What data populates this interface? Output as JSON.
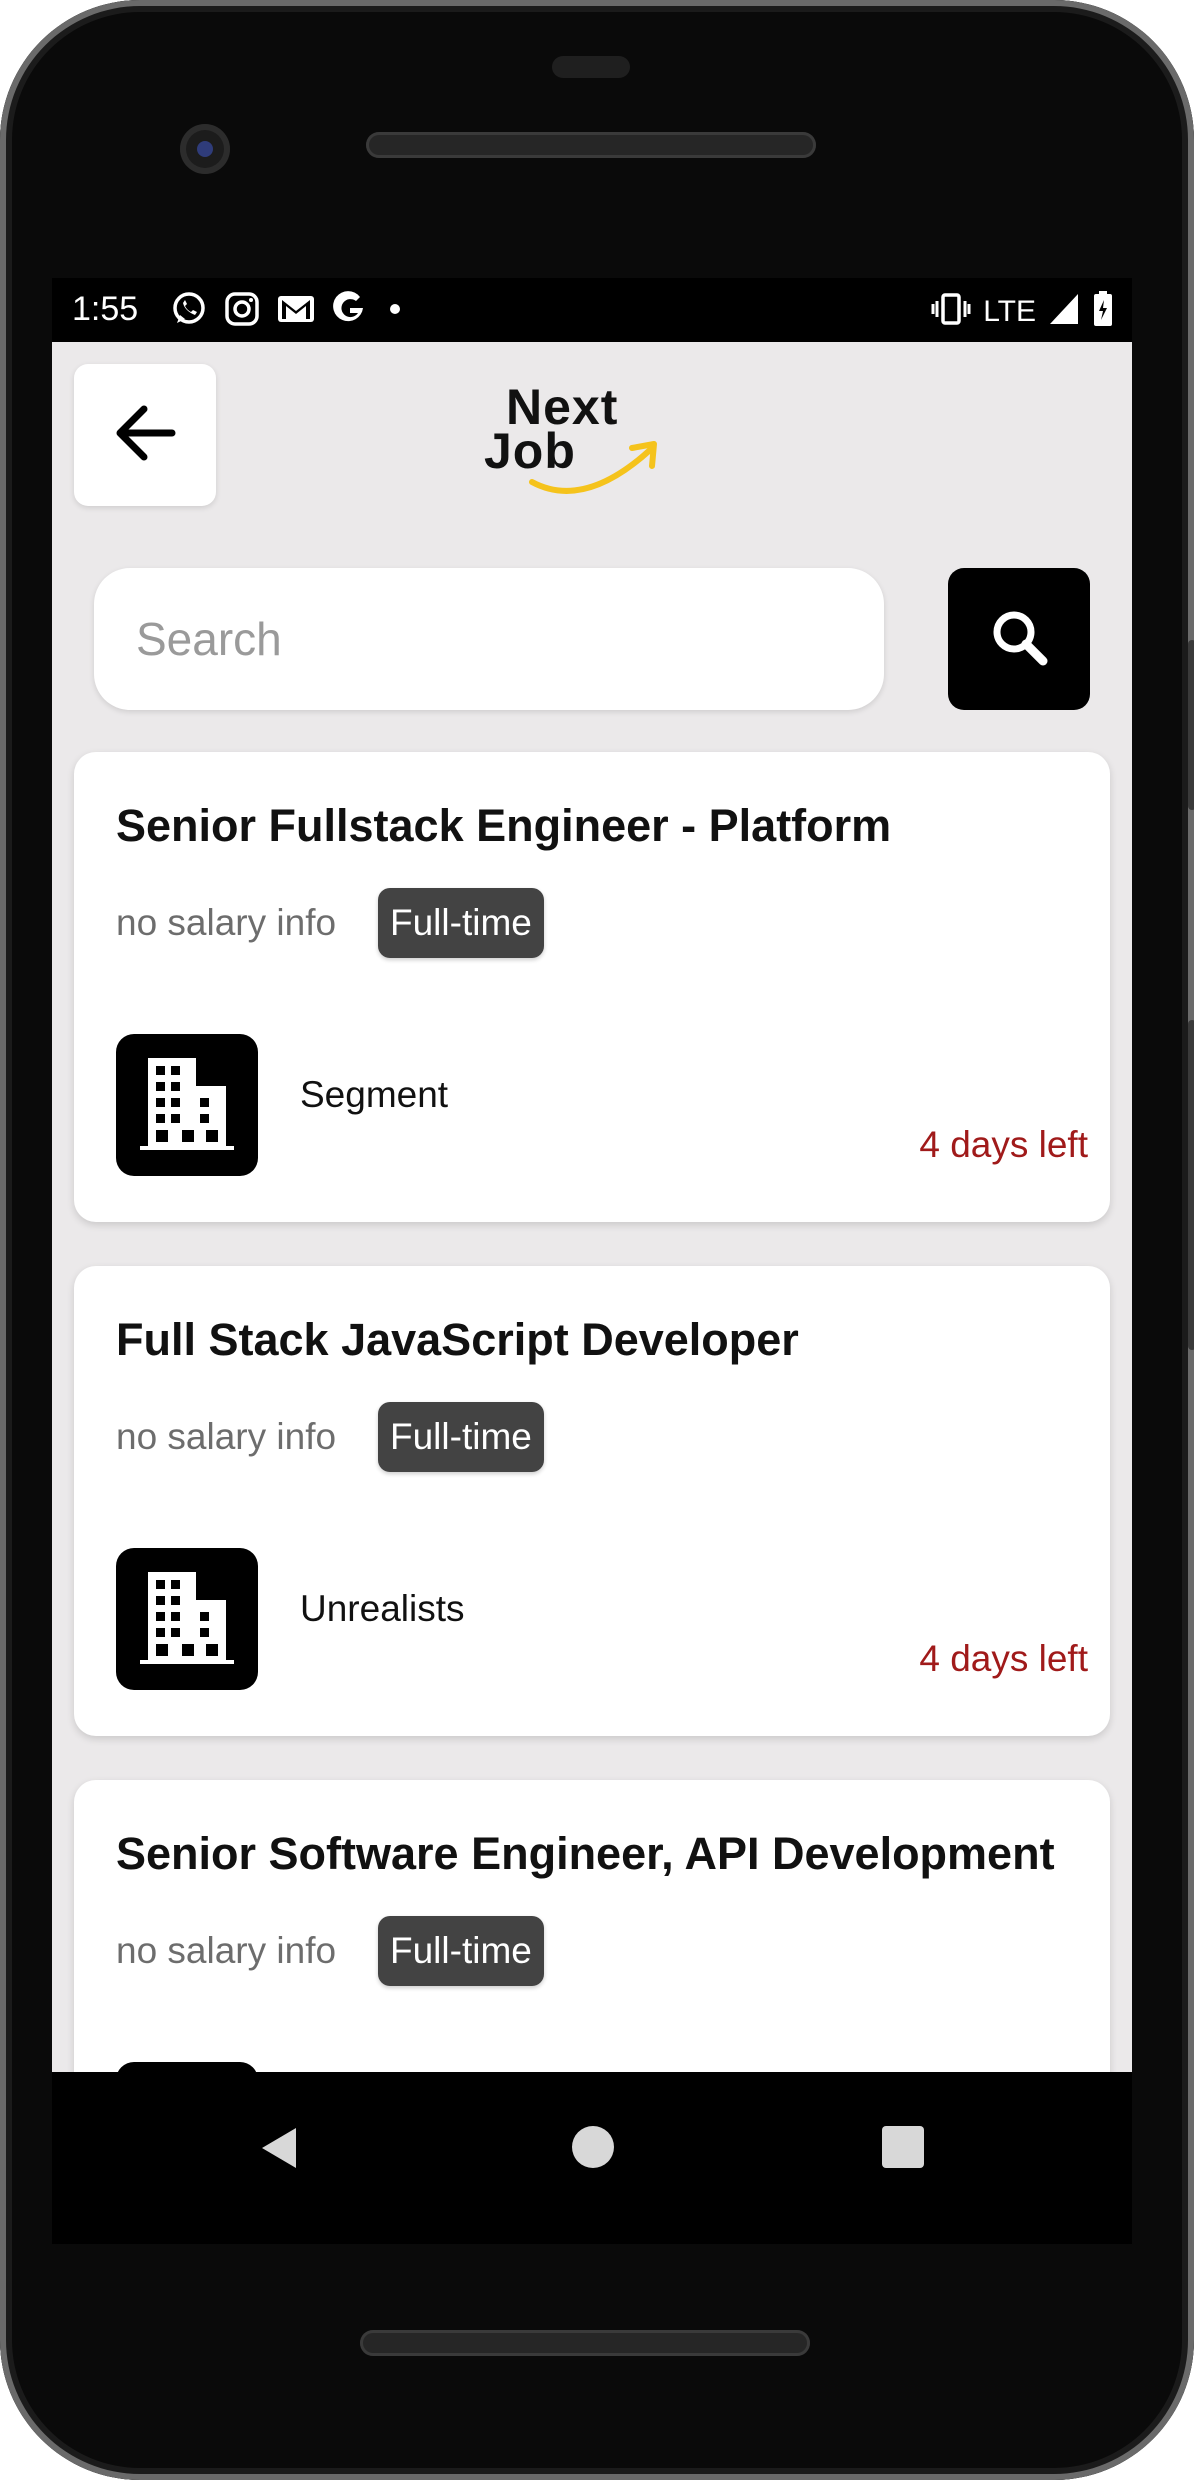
{
  "status_bar": {
    "time": "1:55",
    "left_icons": [
      "whatsapp-icon",
      "instagram-icon",
      "gmail-icon",
      "google-icon",
      "dot-icon"
    ],
    "network": "LTE",
    "right_icons": [
      "vibrate-icon",
      "signal-icon",
      "battery-icon"
    ]
  },
  "header": {
    "back_icon": "arrow-left-icon",
    "logo": {
      "line1": "Next",
      "line2": "Job",
      "accent_color": "#f5c31c"
    }
  },
  "search": {
    "placeholder": "Search",
    "value": "",
    "button_icon": "search-icon"
  },
  "jobs": [
    {
      "title": "Senior Fullstack Engineer - Platform",
      "salary": "no salary info",
      "type": "Full-time",
      "company": "Segment",
      "days_left": "4 days left"
    },
    {
      "title": "Full Stack JavaScript Developer",
      "salary": "no salary info",
      "type": "Full-time",
      "company": "Unrealists",
      "days_left": "4 days left"
    },
    {
      "title": "Senior Software Engineer, API Development",
      "salary": "no salary info",
      "type": "Full-time",
      "company": "",
      "days_left": ""
    }
  ],
  "nav_bar": {
    "icons": [
      "back-triangle-icon",
      "home-circle-icon",
      "recents-square-icon"
    ]
  },
  "colors": {
    "background": "#ebe9ea",
    "card": "#ffffff",
    "tag": "#434343",
    "days_left": "#a01a1a",
    "search_button": "#000000"
  }
}
